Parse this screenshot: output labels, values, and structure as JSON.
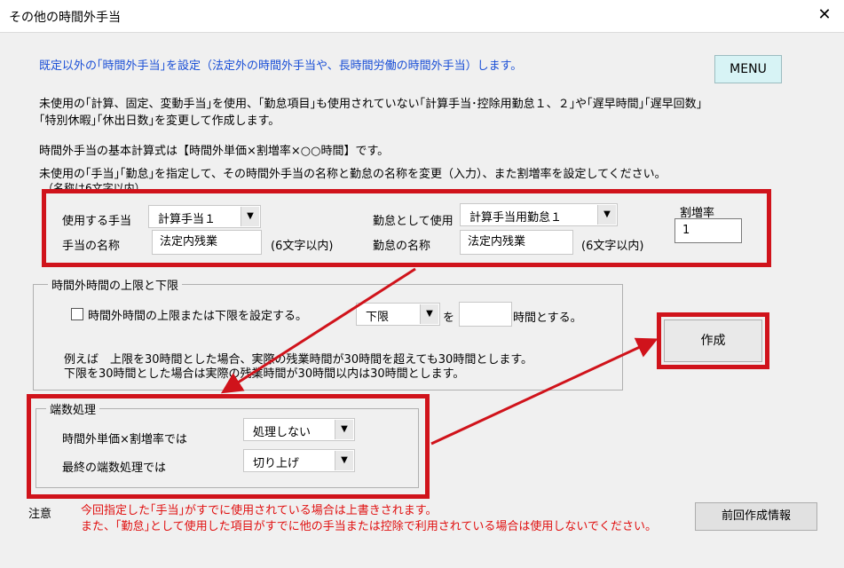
{
  "window": {
    "title": "その他の時間外手当",
    "close_glyph": "✕"
  },
  "intro": {
    "line1": "既定以外の｢時間外手当｣を設定（法定外の時間外手当や、長時間労働の時間外手当）します。",
    "line2": "未使用の｢計算、固定、変動手当｣を使用、｢勤怠項目｣も使用されていない｢計算手当･控除用勤怠１、２｣や｢遅早時間｣｢遅早回数｣",
    "line3": "｢特別休暇｣｢休出日数｣を変更して作成します。",
    "line4": "時間外手当の基本計算式は【時間外単価×割増率×○○時間】です。",
    "line5": "未使用の｢手当｣｢勤怠｣を指定して、その時間外手当の名称と勤怠の名称を変更（入力）、また割増率を設定してください。",
    "line6": "（名称は6文字以内）"
  },
  "menu_button": "MENU",
  "settings": {
    "allowance_label": "使用する手当",
    "allowance_value": "計算手当１",
    "allowance_name_label": "手当の名称",
    "allowance_name_value": "法定内残業",
    "allowance_name_hint": "(6文字以内)",
    "attendance_label": "勤怠として使用",
    "attendance_value": "計算手当用勤怠１",
    "attendance_name_label": "勤怠の名称",
    "attendance_name_value": "法定内残業",
    "attendance_name_hint": "(6文字以内)",
    "rate_label": "割増率",
    "rate_value": "1"
  },
  "limit_group": {
    "title": "時間外時間の上限と下限",
    "checkbox_label": "時間外時間の上限または下限を設定する。",
    "limit_type": "下限",
    "wo": "を",
    "hours_value": "",
    "hours_suffix": "時間とする。",
    "example1": "例えば　上限を30時間とした場合、実際の残業時間が30時間を超えても30時間とします。",
    "example2": "下限を30時間とした場合は実際の残業時間が30時間以内は30時間とします。"
  },
  "create_button": "作成",
  "rounding_group": {
    "title": "端数処理",
    "row1_label": "時間外単価×割増率では",
    "row1_value": "処理しない",
    "row2_label": "最終の端数処理では",
    "row2_value": "切り上げ"
  },
  "notes": {
    "label": "注意",
    "line1": "今回指定した｢手当｣がすでに使用されている場合は上書きされます。",
    "line2": "また、｢勤怠｣として使用した項目がすでに他の手当または控除で利用されている場合は使用しないでください。"
  },
  "prev_button": "前回作成情報",
  "colors": {
    "highlight": "#d0131b",
    "info_text": "#1a4fd6",
    "warning_text": "#e01010",
    "menu_bg": "#d7f3f5"
  }
}
